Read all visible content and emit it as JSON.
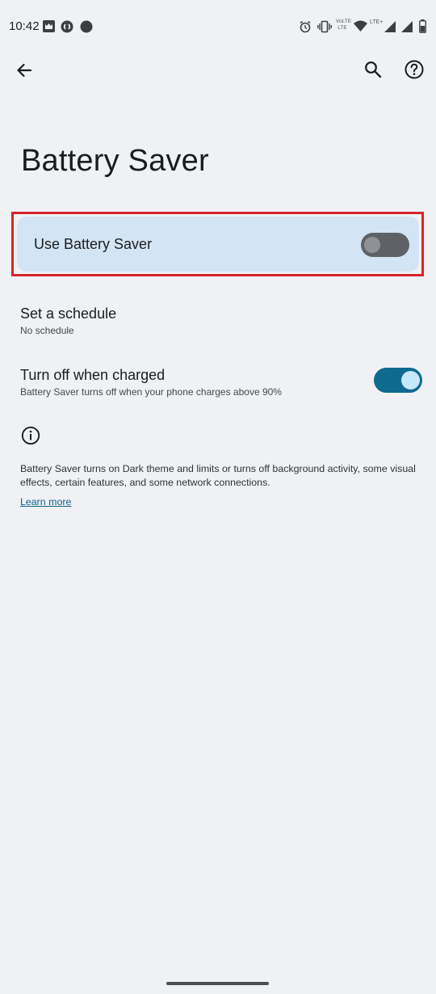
{
  "status_bar": {
    "time": "10:42",
    "left_icons": [
      "mcafee-icon",
      "shazam-icon",
      "notification-dot-icon"
    ],
    "right_icons": [
      "alarm-icon",
      "vibrate-icon",
      "volte-icon",
      "wifi-icon",
      "signal-icon",
      "signal-icon",
      "battery-icon"
    ],
    "volte_label_top": "VoLTE",
    "volte_label_bottom": "LTE",
    "lte_label": "LTE+"
  },
  "app_bar": {
    "back_icon": "arrow-back-icon",
    "search_icon": "search-icon",
    "help_icon": "help-icon"
  },
  "page": {
    "title": "Battery Saver"
  },
  "main_switch": {
    "label": "Use Battery Saver",
    "checked": false,
    "highlight_color": "#d8242c"
  },
  "preferences": [
    {
      "title": "Set a schedule",
      "summary": "No schedule"
    },
    {
      "title": "Turn off when charged",
      "summary": "Battery Saver turns off when your phone charges above 90%",
      "checked": true
    }
  ],
  "footer": {
    "info_icon": "info-icon",
    "text": "Battery Saver turns on Dark theme and limits or turns off background activity, some visual effects, certain features, and some network connections.",
    "learn_more": "Learn more"
  },
  "colors": {
    "background": "#f0f1f4",
    "switch_on": "#0f6a8f",
    "card": "#d3e4f4",
    "link": "#0f5f8a"
  }
}
